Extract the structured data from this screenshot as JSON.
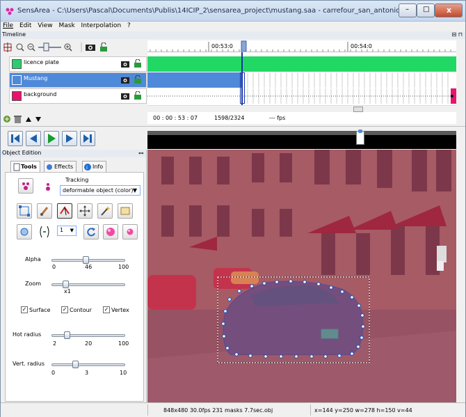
{
  "window": {
    "title": "SensArea - C:\\Users\\Pascal\\Documents\\Publis\\14ICIP_2\\sensarea_project\\mustang.saa - carrefour_san_antonio.MPG",
    "minimize": "–",
    "maximize": "□",
    "close": "x"
  },
  "menu": [
    "File",
    "Edit",
    "View",
    "Mask",
    "Interpolation",
    "?"
  ],
  "timeline": {
    "header": "Timeline",
    "header_pin": "⊟ ⊓",
    "ruler_labels": [
      "00:53:0",
      "00:54:0"
    ],
    "tracks": [
      {
        "name": "licence plate",
        "color": "#2ecc71"
      },
      {
        "name": "Mustang",
        "color": "#4f89d9"
      },
      {
        "name": "background",
        "color": "#e8146c"
      }
    ],
    "frame_time": "00 : 00 : 53 : 07",
    "frame_count": "1598/2324",
    "fps": "--- fps"
  },
  "object_edition": {
    "header": "Object Edition",
    "tabs": [
      "Tools",
      "Effects",
      "Info"
    ],
    "tracking_label": "Tracking",
    "tracking_mode": "deformable object (color)",
    "stepper_value": "1",
    "alpha_label": "Alpha",
    "alpha_min": "0",
    "alpha_value": "46",
    "alpha_max": "100",
    "alpha_level": 0.46,
    "zoom_label": "Zoom",
    "zoom_value": "x1",
    "checkboxes": [
      {
        "label": "Surface",
        "checked": true
      },
      {
        "label": "Contour",
        "checked": true
      },
      {
        "label": "Vertex",
        "checked": true
      }
    ],
    "hot_radius_label": "Hot radius",
    "hot_min": "2",
    "hot_value": "20",
    "hot_max": "100",
    "vert_radius_label": "Vert. radius",
    "vert_min": "0",
    "vert_value": "3",
    "vert_max": "10"
  },
  "status": {
    "video_info": "848x480  30.0fps  231 masks  7.7sec.obj",
    "coords": "x=144  y=250  w=278  h=150  v=44"
  },
  "colors": {
    "overlay": "#c8365c",
    "accent": "#4f89d9",
    "green": "#21d864"
  }
}
